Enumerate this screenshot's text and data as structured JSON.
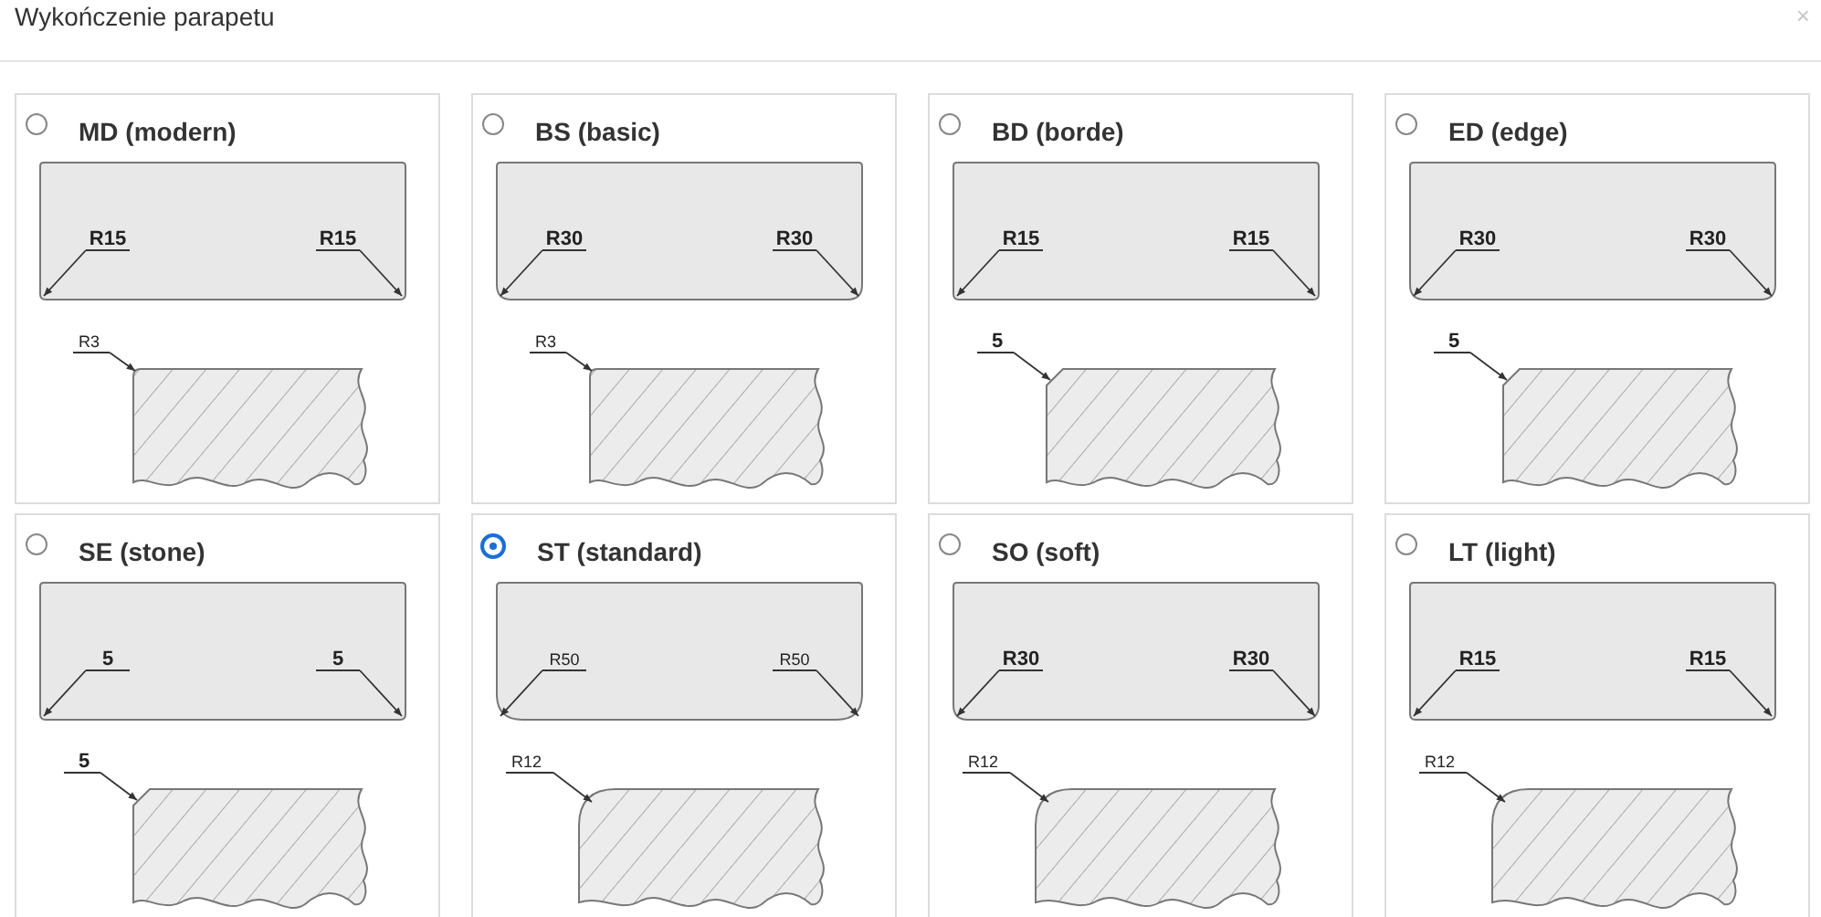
{
  "dialog": {
    "title": "Wykończenie parapetu",
    "close": "×"
  },
  "options": [
    {
      "label": "MD (modern)",
      "selected": false,
      "plan": {
        "left_label": "R15",
        "right_label": "R15",
        "kind": "small"
      },
      "profile": {
        "label": "R3",
        "kind": "round-small"
      }
    },
    {
      "label": "BS (basic)",
      "selected": false,
      "plan": {
        "left_label": "R30",
        "right_label": "R30",
        "kind": "medium"
      },
      "profile": {
        "label": "R3",
        "kind": "round-small"
      }
    },
    {
      "label": "BD (borde)",
      "selected": false,
      "plan": {
        "left_label": "R15",
        "right_label": "R15",
        "kind": "small"
      },
      "profile": {
        "label": "5",
        "kind": "chamfer"
      }
    },
    {
      "label": "ED (edge)",
      "selected": false,
      "plan": {
        "left_label": "R30",
        "right_label": "R30",
        "kind": "medium"
      },
      "profile": {
        "label": "5",
        "kind": "chamfer"
      }
    },
    {
      "label": "SE (stone)",
      "selected": false,
      "plan": {
        "left_label": "5",
        "right_label": "5",
        "kind": "small"
      },
      "profile": {
        "label": "5",
        "kind": "chamfer"
      }
    },
    {
      "label": "ST (standard)",
      "selected": true,
      "plan": {
        "left_label": "R50",
        "right_label": "R50",
        "kind": "large"
      },
      "profile": {
        "label": "R12",
        "kind": "round-large"
      }
    },
    {
      "label": "SO (soft)",
      "selected": false,
      "plan": {
        "left_label": "R30",
        "right_label": "R30",
        "kind": "medium"
      },
      "profile": {
        "label": "R12",
        "kind": "round-large"
      }
    },
    {
      "label": "LT (light)",
      "selected": false,
      "plan": {
        "left_label": "R15",
        "right_label": "R15",
        "kind": "small"
      },
      "profile": {
        "label": "R12",
        "kind": "round-large"
      }
    }
  ]
}
